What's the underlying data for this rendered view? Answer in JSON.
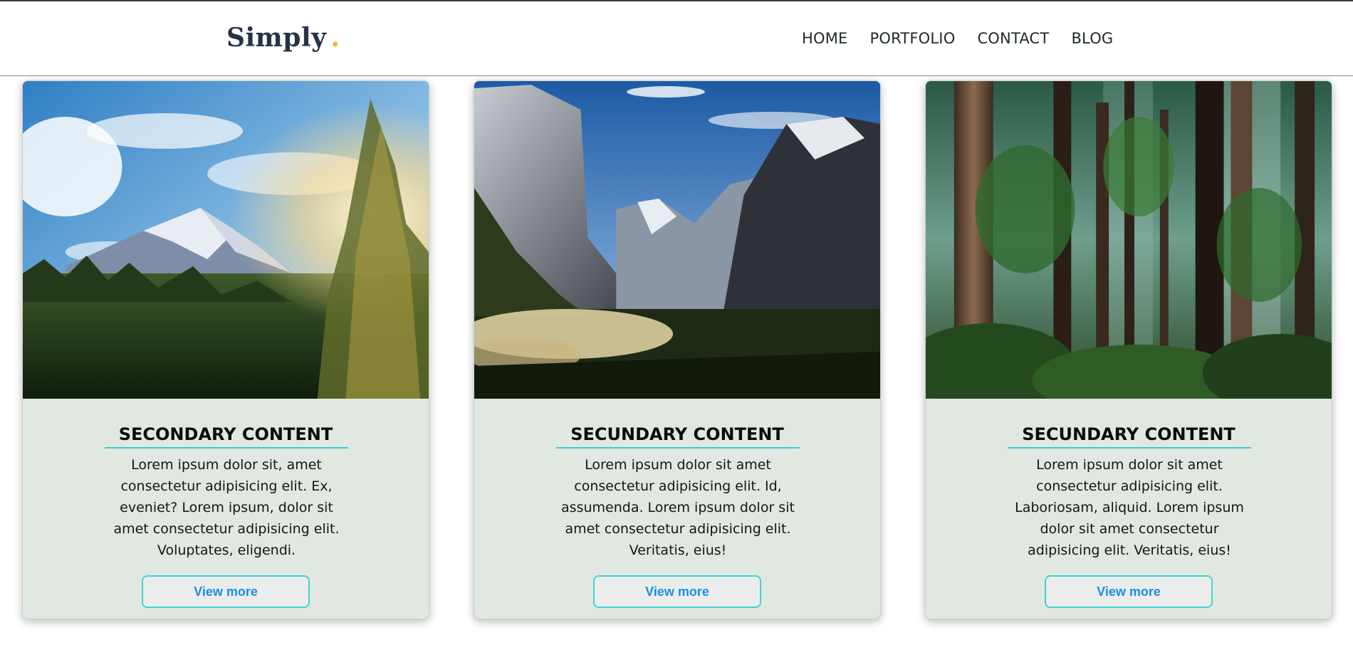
{
  "header": {
    "logo_text": "Simply",
    "logo_dot": ".",
    "nav": [
      "HOME",
      "PORTFOLIO",
      "CONTACT",
      "BLOG"
    ]
  },
  "cards": [
    {
      "title": "SECONDARY CONTENT",
      "text": "Lorem ipsum dolor sit, amet consectetur adipisicing elit. Ex, eveniet? Lorem ipsum, dolor sit amet consectetur adipisicing elit. Voluptates, eligendi.",
      "button": "View more"
    },
    {
      "title": "SECUNDARY CONTENT",
      "text": "Lorem ipsum dolor sit amet consectetur adipisicing elit. Id, assumenda. Lorem ipsum dolor sit amet consectetur adipisicing elit. Veritatis, eius!",
      "button": "View more"
    },
    {
      "title": "SECUNDARY CONTENT",
      "text": "Lorem ipsum dolor sit amet consectetur adipisicing elit. Laboriosam, aliquid. Lorem ipsum dolor sit amet consectetur adipisicing elit. Veritatis, eius!",
      "button": "View more"
    }
  ],
  "colors": {
    "accent_line": "#3fc8d2",
    "button_border": "#3fd3d8",
    "button_text": "#1b8de2",
    "card_bg": "#e1e7e1",
    "logo_dot": "#f0b21c",
    "logo_text": "#243346"
  }
}
